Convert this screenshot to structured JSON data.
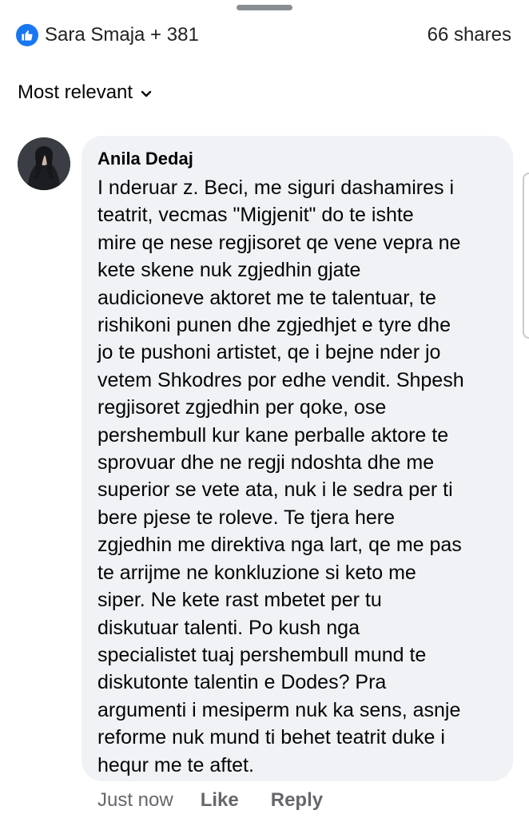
{
  "header": {
    "reactions_text": "Sara Smaja + 381",
    "shares_text": "66 shares"
  },
  "sort": {
    "label": "Most relevant"
  },
  "comment": {
    "author": "Anila Dedaj",
    "text": "I nderuar z. Beci, me siguri dashamires i\nteatrit, vecmas \"Migjenit\" do te ishte\nmire qe nese regjisoret qe vene vepra ne\nkete skene nuk zgjedhin gjate\naudicioneve aktoret me te talentuar, te\nrishikoni punen dhe zgjedhjet e tyre dhe\njo te pushoni artistet, qe i bejne nder jo\nvetem Shkodres por edhe vendit. Shpesh\nregjisoret zgjedhin per qoke, ose\npershembull kur kane perballe aktore te\nsprovuar dhe ne regji ndoshta dhe me\nsuperior se vete ata, nuk i le sedra per ti\nbere pjese te roleve. Te tjera here\nzgjedhin me direktiva nga lart, qe me pas\nte arrijme ne konkluzione si keto me\nsiper. Ne kete rast mbetet per tu\ndiskutuar talenti. Po kush nga\nspecialistet tuaj pershembull mund te\ndiskutonte talentin e Dodes? Pra\nargumenti i mesiperm nuk ka sens, asnje\nreforme nuk mund ti behet teatrit duke i\nhequr me te aftet.",
    "timestamp": "Just now",
    "like_label": "Like",
    "reply_label": "Reply"
  },
  "colors": {
    "accent": "#1877f2",
    "bubble": "#f0f2f5",
    "meta_text": "#65676b"
  },
  "icons": {
    "reaction": "like-icon",
    "sort": "chevron-down-icon"
  }
}
